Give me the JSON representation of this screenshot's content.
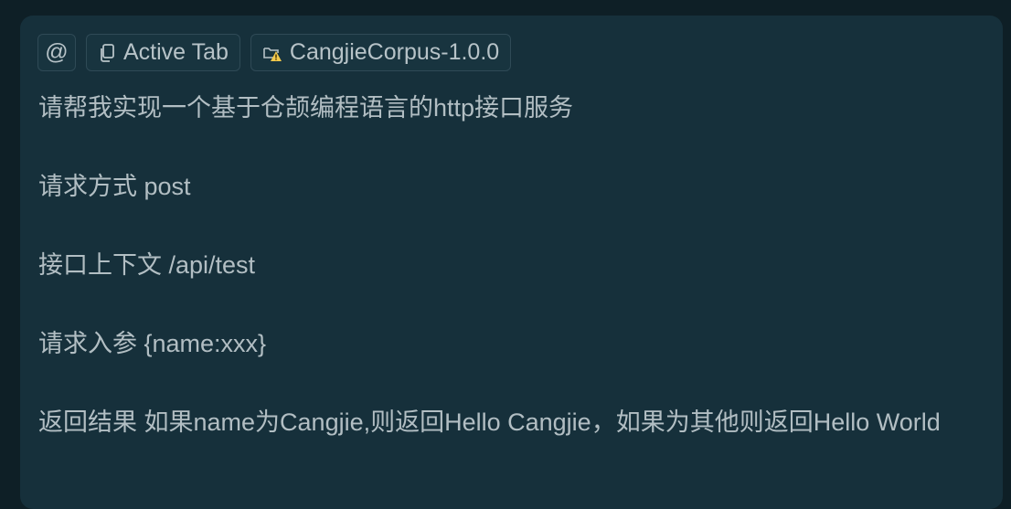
{
  "toolbar": {
    "mention_symbol": "@",
    "active_tab_label": "Active Tab",
    "project_label": "CangjieCorpus-1.0.0",
    "icons": {
      "mention": "at-icon",
      "active_tab": "copy-file-icon",
      "project": "folder-warning-icon"
    },
    "colors": {
      "warning": "#f2c94c"
    }
  },
  "message": {
    "line1": "请帮我实现一个基于仓颉编程语言的http接口服务",
    "line2": "请求方式 post",
    "line3": "接口上下文 /api/test",
    "line4": "请求入参 {name:xxx}",
    "line5": "返回结果 如果name为Cangjie,则返回Hello Cangjie，如果为其他则返回Hello World"
  }
}
